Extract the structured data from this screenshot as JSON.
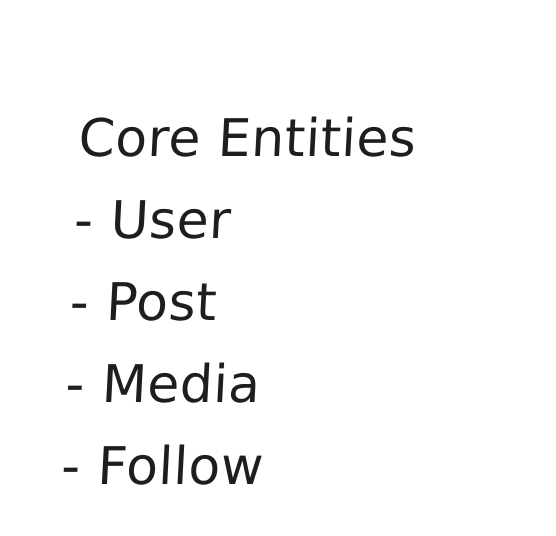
{
  "note": {
    "heading": "Core Entities",
    "items": [
      "- User",
      "- Post",
      "- Media",
      "- Follow"
    ]
  },
  "colors": {
    "background": "#ffffff",
    "ink": "#1e1e1e"
  }
}
